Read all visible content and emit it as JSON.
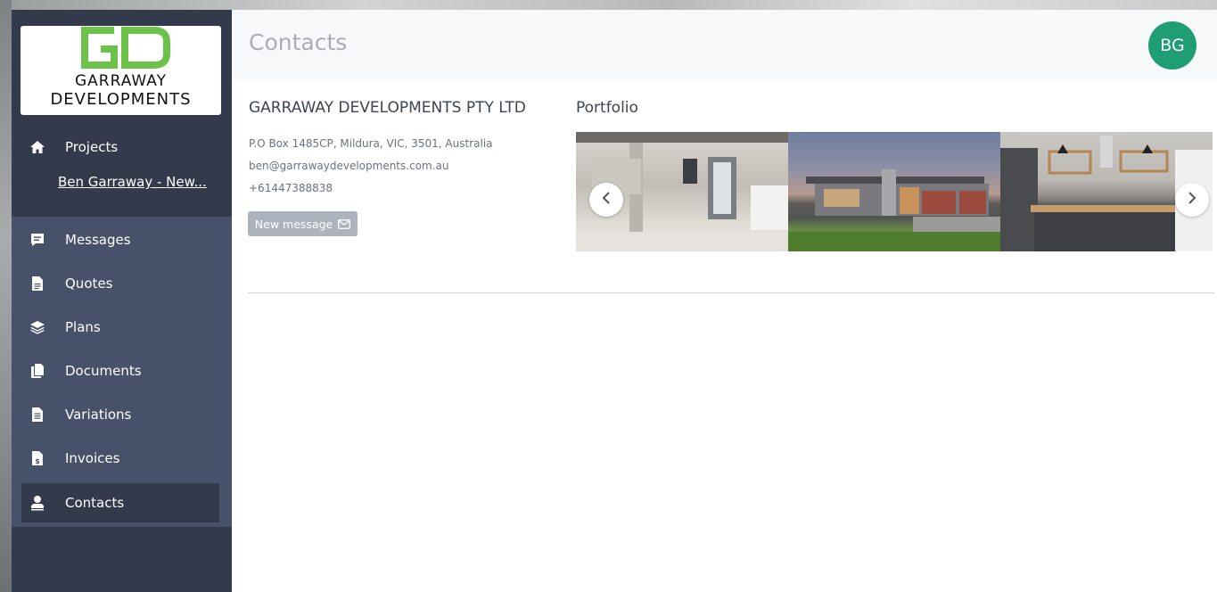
{
  "logo": {
    "mark": "GD",
    "line1": "GARRAWAY",
    "line2": "DEVELOPMENTS",
    "mark_color": "#6cc24a"
  },
  "sidebar": {
    "projects_label": "Projects",
    "current_project": "Ben Garraway - New...",
    "items": [
      {
        "label": "Messages",
        "icon": "message-icon"
      },
      {
        "label": "Quotes",
        "icon": "document-icon"
      },
      {
        "label": "Plans",
        "icon": "layers-icon"
      },
      {
        "label": "Documents",
        "icon": "copy-icon"
      },
      {
        "label": "Variations",
        "icon": "file-text-icon"
      },
      {
        "label": "Invoices",
        "icon": "invoice-icon"
      },
      {
        "label": "Contacts",
        "icon": "user-icon",
        "active": true
      }
    ]
  },
  "header": {
    "title": "Contacts",
    "avatar_initials": "BG",
    "avatar_color": "#1f9e76"
  },
  "contact": {
    "company": "GARRAWAY DEVELOPMENTS PTY LTD",
    "address": "P.O Box 1485CP, Mildura, VIC, 3501, Australia",
    "email": "ben@garrawaydevelopments.com.au",
    "phone": "+61447388838",
    "new_message_label": "New message"
  },
  "portfolio": {
    "title": "Portfolio"
  }
}
